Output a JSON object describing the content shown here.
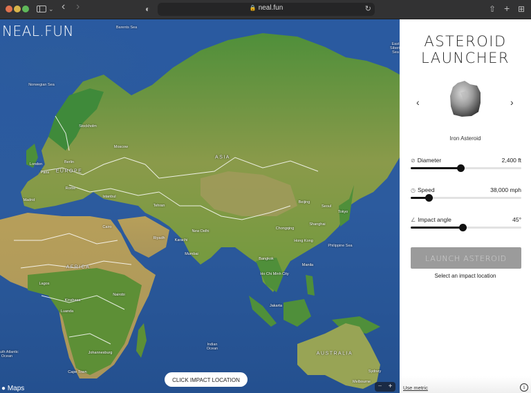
{
  "browser": {
    "url": "neal.fun",
    "lock_icon": "🔒",
    "reload_icon": "↻",
    "back_icon": "‹",
    "forward_icon": "›",
    "shield_icon": "◐",
    "chevron_icon": "⌄",
    "share_icon": "⇧",
    "new_tab_icon": "+",
    "tabs_icon": "⊞"
  },
  "map": {
    "logo": "NEAL.FUN",
    "brand": " Maps",
    "click_button": "CLICK IMPACT LOCATION",
    "zoom_out": "−",
    "zoom_in": "+",
    "labels": [
      {
        "text": "Barents Sea",
        "kind": "ocean"
      },
      {
        "text": "Norwegian Sea",
        "kind": "ocean"
      },
      {
        "text": "Stockholm",
        "kind": "city"
      },
      {
        "text": "Moscow",
        "kind": "city"
      },
      {
        "text": "London",
        "kind": "city"
      },
      {
        "text": "Berlin",
        "kind": "city"
      },
      {
        "text": "Paris",
        "kind": "city"
      },
      {
        "text": "EUROPE",
        "kind": "continent"
      },
      {
        "text": "Rome",
        "kind": "city"
      },
      {
        "text": "Madrid",
        "kind": "city"
      },
      {
        "text": "Istanbul",
        "kind": "city"
      },
      {
        "text": "ASIA",
        "kind": "continent"
      },
      {
        "text": "Tehran",
        "kind": "city"
      },
      {
        "text": "Cairo",
        "kind": "city"
      },
      {
        "text": "Riyadh",
        "kind": "city"
      },
      {
        "text": "Karachi",
        "kind": "city"
      },
      {
        "text": "New Delhi",
        "kind": "city"
      },
      {
        "text": "Mumbai",
        "kind": "city"
      },
      {
        "text": "Beijing",
        "kind": "city"
      },
      {
        "text": "Seoul",
        "kind": "city"
      },
      {
        "text": "Tokyo",
        "kind": "city"
      },
      {
        "text": "Shanghai",
        "kind": "city"
      },
      {
        "text": "Chongqing",
        "kind": "city"
      },
      {
        "text": "Hong Kong",
        "kind": "city"
      },
      {
        "text": "Philippine Sea",
        "kind": "ocean"
      },
      {
        "text": "Manila",
        "kind": "city"
      },
      {
        "text": "Bangkok",
        "kind": "city"
      },
      {
        "text": "Ho Chi Minh City",
        "kind": "city"
      },
      {
        "text": "Jakarta",
        "kind": "city"
      },
      {
        "text": "AFRICA",
        "kind": "continent"
      },
      {
        "text": "Lagos",
        "kind": "city"
      },
      {
        "text": "Nairobi",
        "kind": "city"
      },
      {
        "text": "Kinshasa",
        "kind": "city"
      },
      {
        "text": "Luanda",
        "kind": "city"
      },
      {
        "text": "Johannesburg",
        "kind": "city"
      },
      {
        "text": "Cape Town",
        "kind": "city"
      },
      {
        "text": "South Atlantic Ocean",
        "kind": "ocean"
      },
      {
        "text": "Indian Ocean",
        "kind": "ocean"
      },
      {
        "text": "AUSTRALIA",
        "kind": "continent"
      },
      {
        "text": "Sydney",
        "kind": "city"
      },
      {
        "text": "Melbourne",
        "kind": "city"
      },
      {
        "text": "East Siberian Sea",
        "kind": "ocean"
      }
    ]
  },
  "panel": {
    "title_line1": "ASTEROID",
    "title_line2": "LAUNCHER",
    "prev_icon": "‹",
    "next_icon": "›",
    "asteroid_name": "Iron Asteroid",
    "controls": [
      {
        "label": "Diameter",
        "icon": "⊘",
        "value": "2,400 ft",
        "fraction": 0.45
      },
      {
        "label": "Speed",
        "icon": "◷",
        "value": "38,000 mph",
        "fraction": 0.16
      },
      {
        "label": "Impact angle",
        "icon": "∠",
        "value": "45°",
        "fraction": 0.47
      }
    ],
    "launch_label": "LAUNCH ASTEROID",
    "hint": "Select an impact location",
    "metric_link": "Use metric",
    "info_icon": "i"
  }
}
